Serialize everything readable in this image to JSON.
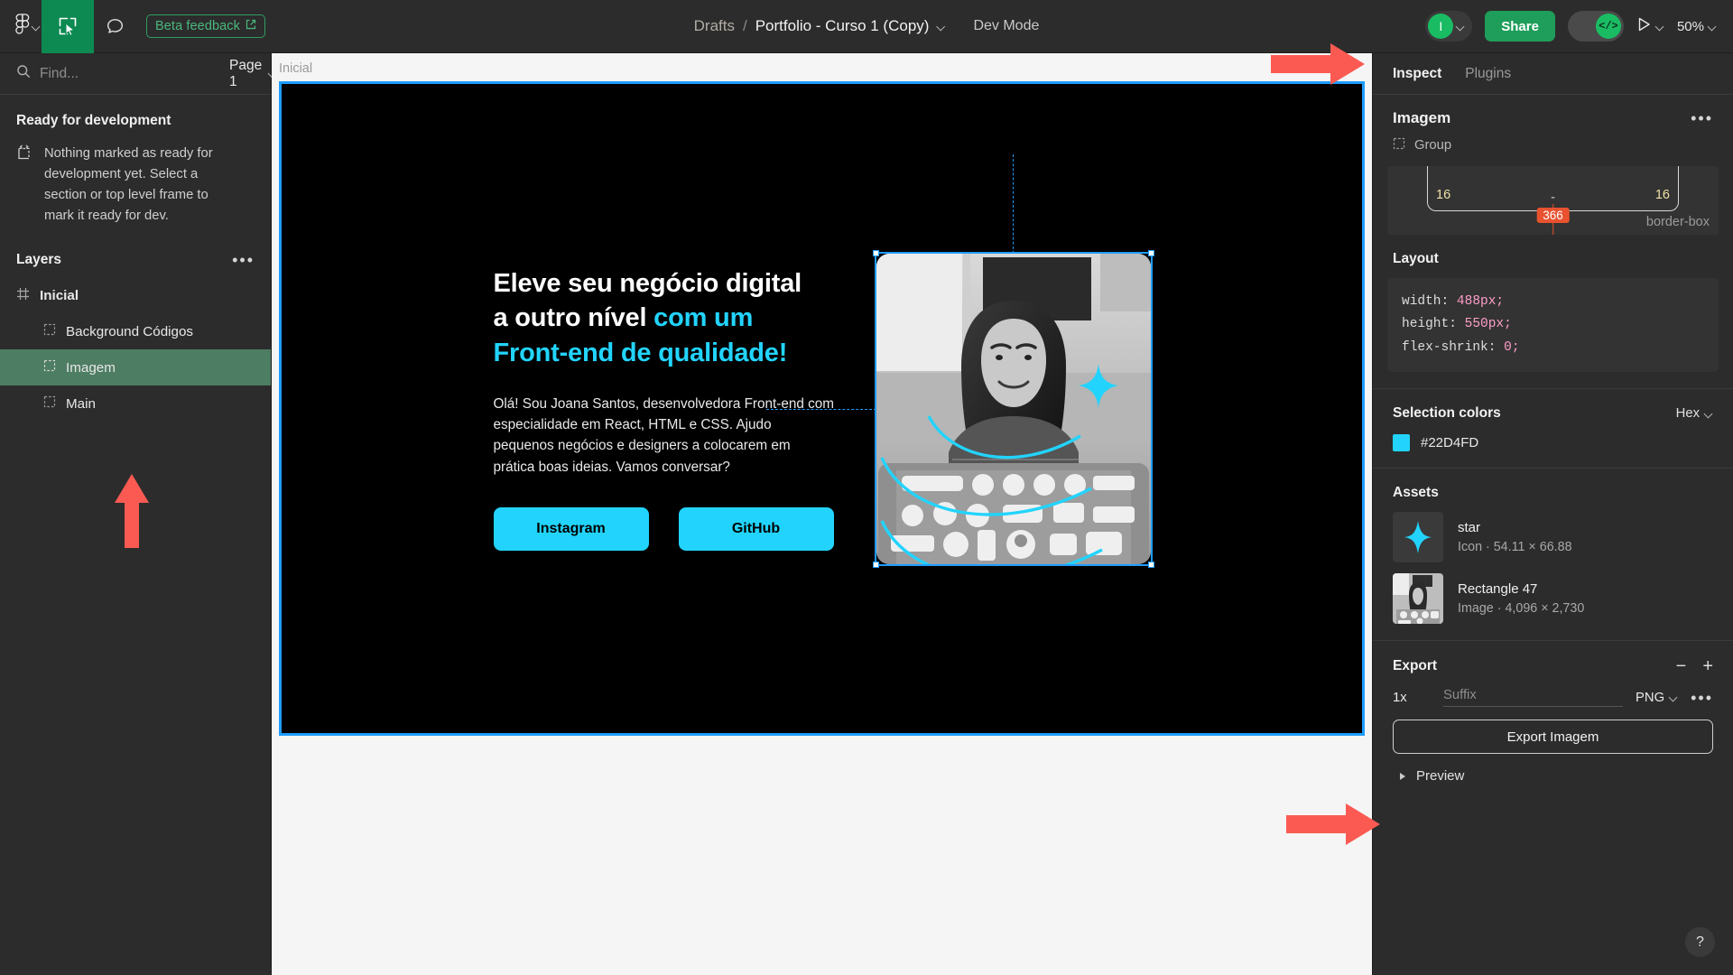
{
  "topbar": {
    "figma_logo": "figma-logo",
    "beta_feedback": "Beta feedback",
    "breadcrumb_root": "Drafts",
    "breadcrumb_sep": "/",
    "breadcrumb_file": "Portfolio - Curso 1 (Copy)",
    "dev_mode": "Dev Mode",
    "avatar_initial": "I",
    "share_label": "Share",
    "code_toggle_glyph": "</>",
    "zoom_level": "50%"
  },
  "left_panel": {
    "find_placeholder": "Find...",
    "find_value": "",
    "page_label": "Page 1",
    "ready_title": "Ready for development",
    "ready_empty_text": "Nothing marked as ready for development yet. Select a section or top level frame to mark it ready for dev.",
    "layers_title": "Layers",
    "layers": [
      {
        "label": "Inicial",
        "type": "frame",
        "selected": false,
        "indent": false
      },
      {
        "label": "Background Códigos",
        "type": "group",
        "selected": false,
        "indent": true
      },
      {
        "label": "Imagem",
        "type": "group",
        "selected": true,
        "indent": true
      },
      {
        "label": "Main",
        "type": "group",
        "selected": false,
        "indent": true
      }
    ]
  },
  "canvas": {
    "frame_label": "Inicial",
    "hero": {
      "headline_line1": "Eleve seu negócio digital",
      "headline_line2_plain": "a outro nível ",
      "headline_line2_accent": "com um",
      "headline_line3_accent": "Front-end de qualidade!",
      "paragraph": "Olá! Sou Joana Santos, desenvolvedora Front-end com especialidade em React, HTML e CSS. Ajudo pequenos negócios e designers a colocarem em prática boas ideias. Vamos conversar?",
      "button_instagram": "Instagram",
      "button_github": "GitHub",
      "accent_color": "#22D4FD",
      "background_color": "#000000"
    }
  },
  "right_panel": {
    "tab_inspect": "Inspect",
    "tab_plugins": "Plugins",
    "selection_name": "Imagem",
    "selection_type": "Group",
    "box_model": {
      "left": "16",
      "center": "-",
      "right": "16",
      "measure_badge": "366",
      "sizing_label": "border-box"
    },
    "layout": {
      "title": "Layout",
      "declarations": [
        {
          "prop": "width:",
          "value": "488px;"
        },
        {
          "prop": "height:",
          "value": "550px;"
        },
        {
          "prop": "flex-shrink:",
          "value": "0;"
        }
      ]
    },
    "selection_colors": {
      "title": "Selection colors",
      "format": "Hex",
      "colors": [
        {
          "hex": "#22D4FD",
          "swatch": "#22D4FD"
        }
      ]
    },
    "assets": {
      "title": "Assets",
      "items": [
        {
          "name": "star",
          "meta": "Icon · 54.11 × 66.88",
          "thumb": "star-icon"
        },
        {
          "name": "Rectangle 47",
          "meta": "Image · 4,096 × 2,730",
          "thumb": "photo-thumb"
        }
      ]
    },
    "export": {
      "title": "Export",
      "scale": "1x",
      "suffix_placeholder": "Suffix",
      "suffix_value": "",
      "format": "PNG",
      "button_label": "Export Imagem",
      "preview_label": "Preview"
    },
    "help_glyph": "?"
  },
  "annotations": {
    "arrow_color": "#FB5A53",
    "arrows": [
      {
        "name": "arrow-to-inspect-panel",
        "direction": "right"
      },
      {
        "name": "arrow-to-imagem-layer",
        "direction": "up"
      },
      {
        "name": "arrow-to-export-button",
        "direction": "right"
      }
    ]
  }
}
